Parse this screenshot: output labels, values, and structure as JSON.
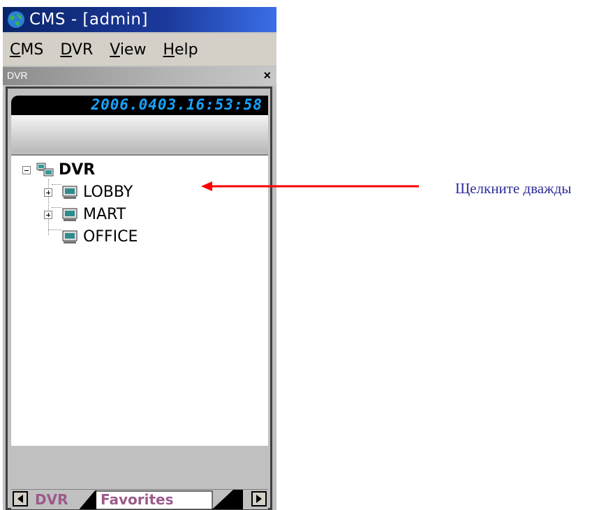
{
  "window": {
    "title": "CMS - [admin]",
    "accent": "#0a246a"
  },
  "menubar": {
    "items": [
      {
        "label": "CMS",
        "mnemonic": "C",
        "rest": "MS"
      },
      {
        "label": "DVR",
        "mnemonic": "D",
        "rest": "VR"
      },
      {
        "label": "View",
        "mnemonic": "V",
        "rest": "iew"
      },
      {
        "label": "Help",
        "mnemonic": "H",
        "rest": "elp"
      }
    ]
  },
  "panel": {
    "title": "DVR",
    "close_glyph": "×",
    "clock": "2006.0403.16:53:58"
  },
  "tree": {
    "root": {
      "label": "DVR",
      "expanded": true,
      "icon": "dvr-group-icon"
    },
    "children": [
      {
        "label": "LOBBY",
        "expandable": true,
        "icon": "monitor-icon"
      },
      {
        "label": "MART",
        "expandable": true,
        "icon": "monitor-icon"
      },
      {
        "label": "OFFICE",
        "expandable": false,
        "icon": "monitor-icon"
      }
    ]
  },
  "tabs": {
    "items": [
      "DVR",
      "Favorites"
    ],
    "active": "Favorites"
  },
  "annotation": {
    "text": "Щелкните дважды",
    "arrow_color": "#ff0000"
  }
}
